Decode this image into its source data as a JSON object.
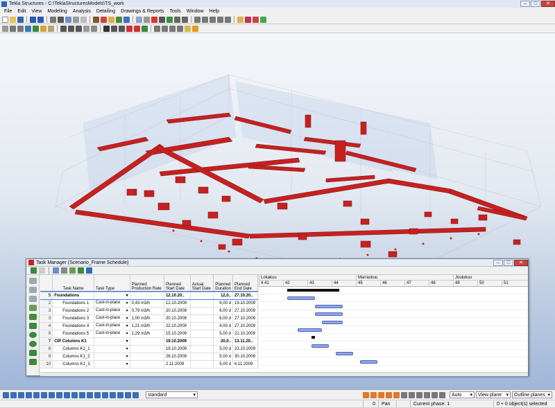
{
  "window": {
    "title": "Tekla Structures - C:\\TeklaStructuresModels\\TS_work"
  },
  "menu": [
    "File",
    "Edit",
    "View",
    "Modeling",
    "Analysis",
    "Detailing",
    "Drawings & Reports",
    "Tools",
    "Window",
    "Help"
  ],
  "task_manager": {
    "title": "Task Manager (Scenario_Frame Schedule)",
    "columns": [
      "Task Name",
      "Task Type",
      "Planned Production Rate",
      "Planned Start Date",
      "Actual Start Date",
      "Planned Duration",
      "Planned End Date"
    ],
    "rows": [
      {
        "n": "5",
        "name": "Foundations",
        "type": "",
        "rate": "",
        "start": "12.10.20..",
        "actual": "",
        "dur": "12,0..",
        "end": "27.10.20..",
        "bold": true
      },
      {
        "n": "2",
        "name": "Foundations 1",
        "type": "Cast-in-place",
        "rate": "0,43 m3/h",
        "start": "12.10.2009",
        "actual": "",
        "dur": "6,00 d",
        "end": "19.10.2009",
        "bold": false
      },
      {
        "n": "3",
        "name": "Foundations 2",
        "type": "Cast-in-place",
        "rate": "0,79 m3/h",
        "start": "20.10.2009",
        "actual": "",
        "dur": "6,00 d",
        "end": "27.10.2009",
        "bold": false
      },
      {
        "n": "3",
        "name": "Foundations 3",
        "type": "Cast-in-place",
        "rate": "1,00 m3/h",
        "start": "20.10.2009",
        "actual": "",
        "dur": "6,00 d",
        "end": "27.10.2009",
        "bold": false
      },
      {
        "n": "4",
        "name": "Foundations 4",
        "type": "Cast-in-place",
        "rate": "1,21 m3/h",
        "start": "22.10.2009",
        "actual": "",
        "dur": "4,00 d",
        "end": "27.10.2009",
        "bold": false
      },
      {
        "n": "5",
        "name": "Foundations 5",
        "type": "Cast-in-place",
        "rate": "1,29 m3/h",
        "start": "15.10.2009",
        "actual": "",
        "dur": "5,00 d",
        "end": "21.10.2009",
        "bold": false
      },
      {
        "n": "7",
        "name": "CIP Columns K1",
        "type": "",
        "rate": "",
        "start": "19.10.2009",
        "actual": "",
        "dur": "20,0..",
        "end": "13.11.20..",
        "bold": true
      },
      {
        "n": "8",
        "name": "Columns K1_1",
        "type": "",
        "rate": "",
        "start": "19.10.2009",
        "actual": "",
        "dur": "5,00 d",
        "end": "23.10.2009",
        "bold": false
      },
      {
        "n": "9",
        "name": "Columns K1_2",
        "type": "",
        "rate": "",
        "start": "26.10.2009",
        "actual": "",
        "dur": "5,00 d",
        "end": "30.10.2009",
        "bold": false
      },
      {
        "n": "10",
        "name": "Columns K1_3",
        "type": "",
        "rate": "",
        "start": "2.11.2009",
        "actual": "",
        "dur": "5,00 d",
        "end": "6.11.2009",
        "bold": false
      }
    ],
    "gantt": {
      "months": [
        "Lokakuu",
        "Marraskuu",
        "Joulukuu"
      ],
      "weeks": [
        "4 41",
        "42",
        "43",
        "44",
        "45",
        "46",
        "47",
        "48",
        "49",
        "50",
        "51"
      ]
    }
  },
  "statusbar": {
    "layout_select": "standard",
    "auto": "Auto",
    "view_plane": "View plane",
    "outline_planes": "Outline planes",
    "count": "0",
    "mode": "Pan",
    "phase": "Current phase: 1",
    "selected": "0 + 0 object(s) selected"
  },
  "colors": {
    "accent": "#c62020",
    "bar": "#8fa6e8",
    "summary": "#111111"
  }
}
